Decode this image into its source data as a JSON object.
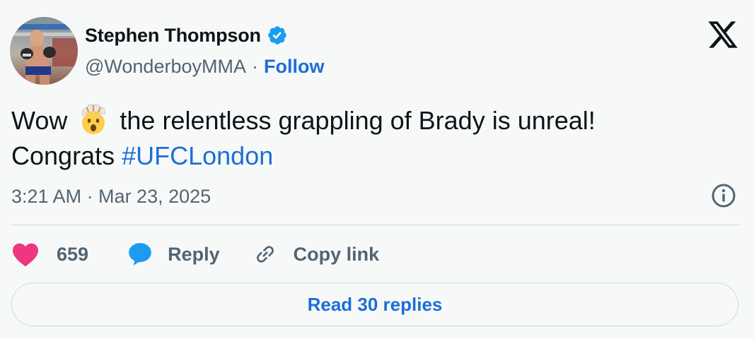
{
  "author": {
    "display_name": "Stephen Thompson",
    "handle": "@WonderboyMMA",
    "separator": "·",
    "follow_label": "Follow",
    "verified": true,
    "avatar_icon": "avatar-photo"
  },
  "tweet": {
    "text_before_emoji": "Wow",
    "emoji": "exploding-head",
    "text_after_emoji": "the relentless grappling of Brady is unreal!",
    "line2_text": "Congrats",
    "hashtag": "#UFCLondon"
  },
  "meta": {
    "timestamp": "3:21 AM · Mar 23, 2025"
  },
  "actions": {
    "like_count": "659",
    "reply_label": "Reply",
    "copy_link_label": "Copy link"
  },
  "footer": {
    "read_replies_label": "Read 30 replies"
  },
  "colors": {
    "accent": "#1d6ed8",
    "like": "#f0367e",
    "secondary_text": "#536471",
    "background": "#f7f9f9"
  }
}
